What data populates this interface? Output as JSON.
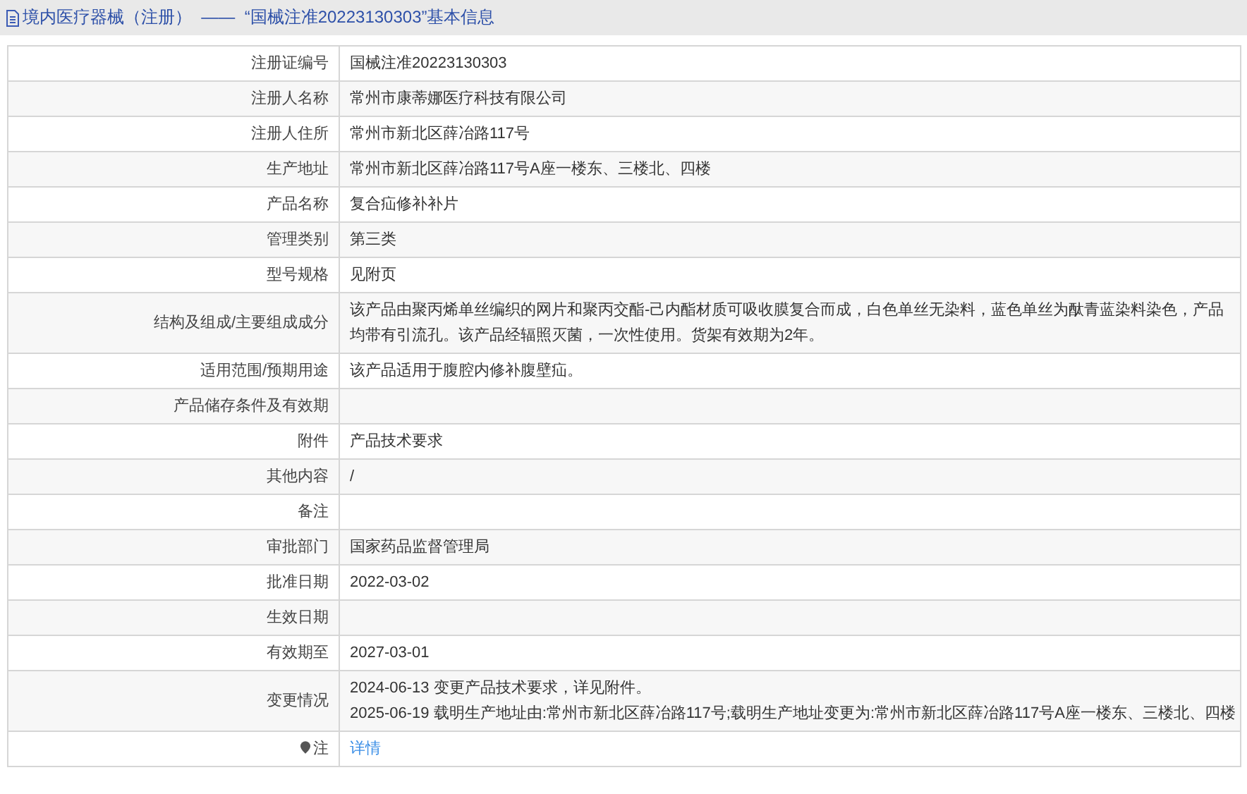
{
  "header": {
    "title": "境内医疗器械（注册）  ——  “国械注准20223130303”基本信息"
  },
  "rows": [
    {
      "kind": "text",
      "label": "注册证编号",
      "lines": [
        "国械注准20223130303"
      ]
    },
    {
      "kind": "text",
      "label": "注册人名称",
      "lines": [
        "常州市康蒂娜医疗科技有限公司"
      ]
    },
    {
      "kind": "text",
      "label": "注册人住所",
      "lines": [
        "常州市新北区薛冶路117号"
      ]
    },
    {
      "kind": "text",
      "label": "生产地址",
      "lines": [
        "常州市新北区薛冶路117号A座一楼东、三楼北、四楼"
      ]
    },
    {
      "kind": "text",
      "label": "产品名称",
      "lines": [
        "复合疝修补补片"
      ]
    },
    {
      "kind": "text",
      "label": "管理类别",
      "lines": [
        "第三类"
      ]
    },
    {
      "kind": "text",
      "label": "型号规格",
      "lines": [
        "见附页"
      ]
    },
    {
      "kind": "text",
      "label": "结构及组成/主要组成成分",
      "lines": [
        "该产品由聚丙烯单丝编织的网片和聚丙交酯-己内酯材质可吸收膜复合而成，白色单丝无染料，蓝色单丝为酞青蓝染料染色，产品均带有引流孔。该产品经辐照灭菌，一次性使用。货架有效期为2年。"
      ]
    },
    {
      "kind": "text",
      "label": "适用范围/预期用途",
      "lines": [
        "该产品适用于腹腔内修补腹壁疝。"
      ]
    },
    {
      "kind": "text",
      "label": "产品储存条件及有效期",
      "lines": []
    },
    {
      "kind": "text",
      "label": "附件",
      "lines": [
        "产品技术要求"
      ]
    },
    {
      "kind": "text",
      "label": "其他内容",
      "lines": [
        "/"
      ]
    },
    {
      "kind": "text",
      "label": "备注",
      "lines": []
    },
    {
      "kind": "text",
      "label": "审批部门",
      "lines": [
        "国家药品监督管理局"
      ]
    },
    {
      "kind": "text",
      "label": "批准日期",
      "lines": [
        "2022-03-02"
      ]
    },
    {
      "kind": "text",
      "label": "生效日期",
      "lines": []
    },
    {
      "kind": "text",
      "label": "有效期至",
      "lines": [
        "2027-03-01"
      ]
    },
    {
      "kind": "text",
      "label": "变更情况",
      "lines": [
        "2024-06-13 变更产品技术要求，详见附件。",
        "2025-06-19 载明生产地址由:常州市新北区薛冶路117号;载明生产地址变更为:常州市新北区薛冶路117号A座一楼东、三楼北、四楼"
      ]
    },
    {
      "kind": "link",
      "label": "注",
      "lines": [
        "详情"
      ]
    }
  ]
}
